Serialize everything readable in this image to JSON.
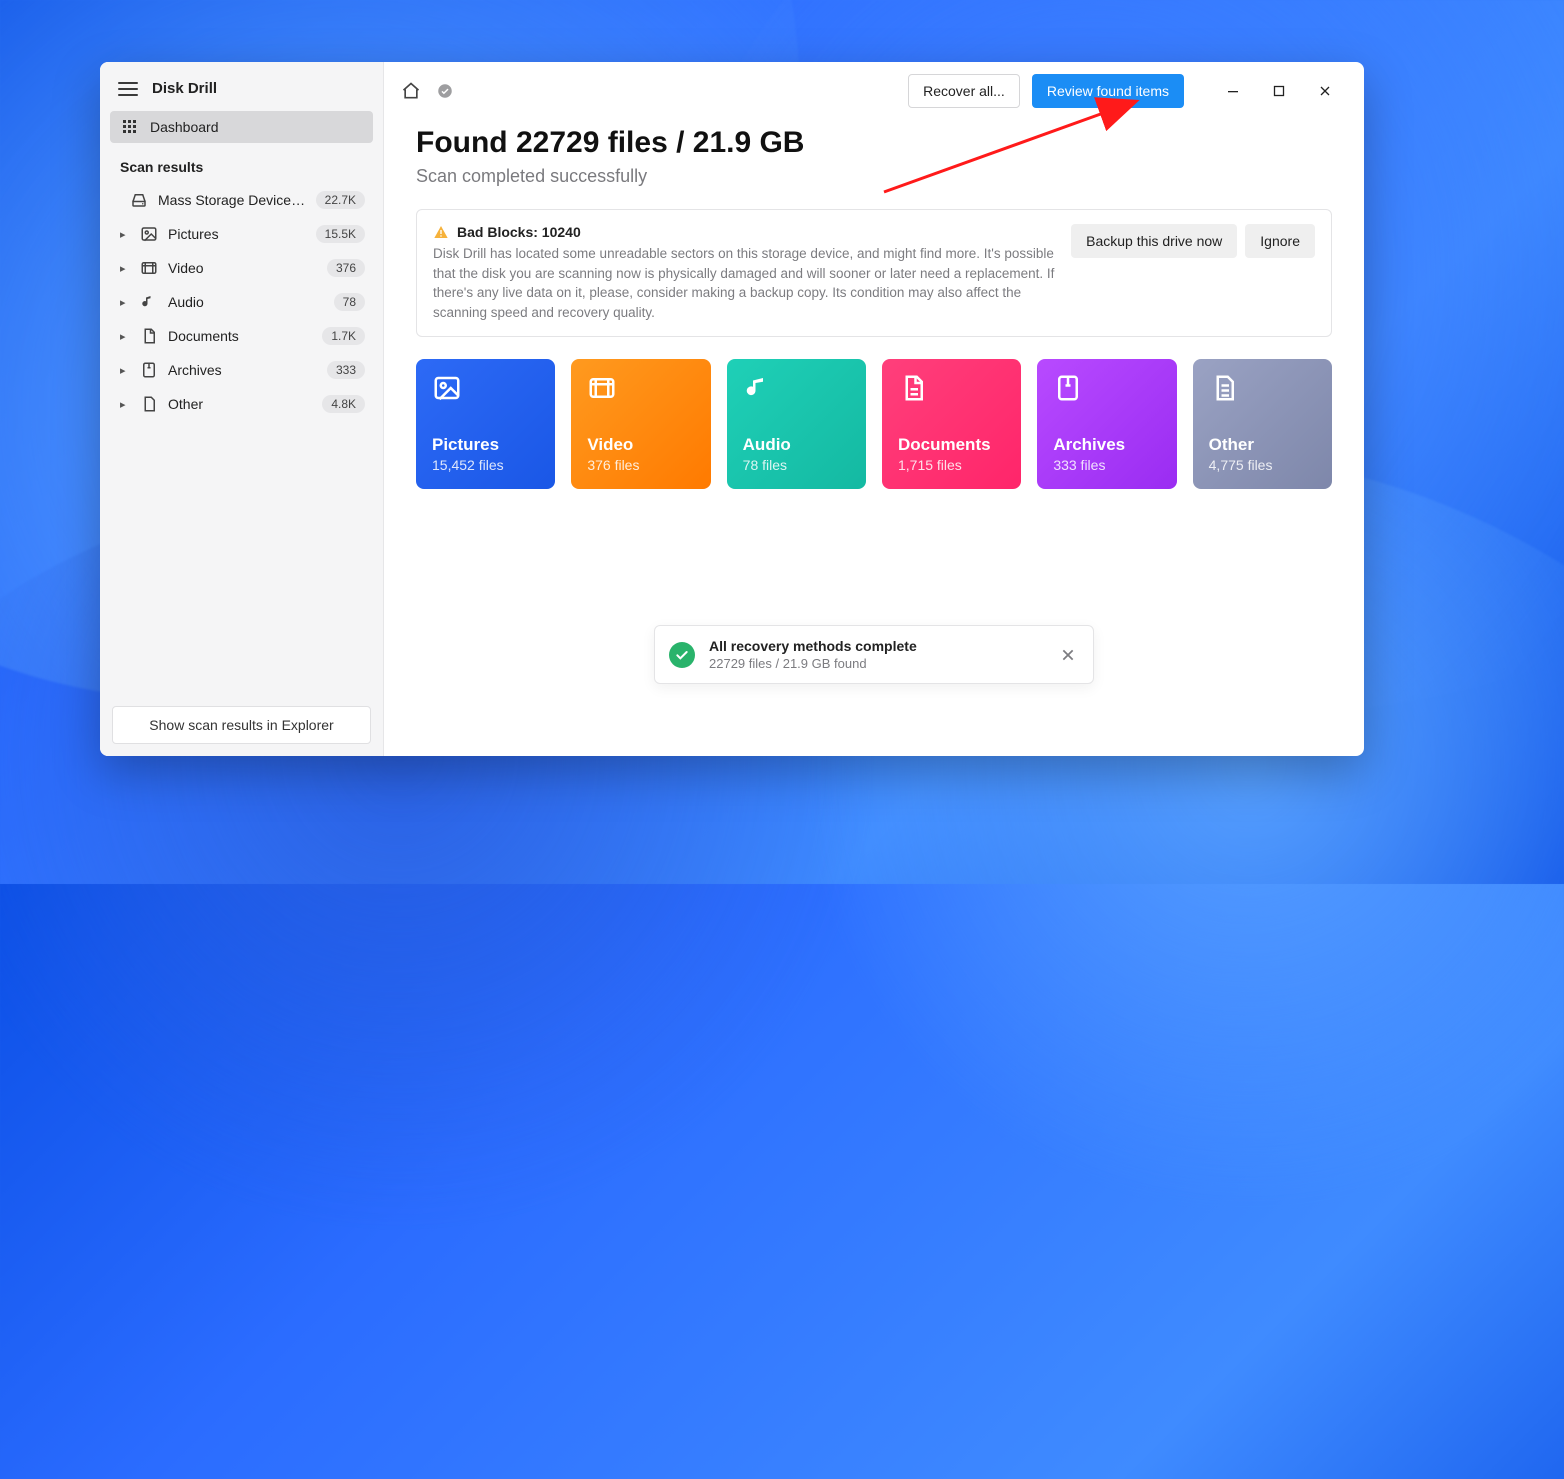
{
  "app": {
    "title": "Disk Drill"
  },
  "sidebar": {
    "dashboard_label": "Dashboard",
    "section_label": "Scan results",
    "device": {
      "label": "Mass Storage Device U...",
      "count": "22.7K"
    },
    "items": [
      {
        "icon": "picture",
        "label": "Pictures",
        "count": "15.5K"
      },
      {
        "icon": "video",
        "label": "Video",
        "count": "376"
      },
      {
        "icon": "audio",
        "label": "Audio",
        "count": "78"
      },
      {
        "icon": "doc",
        "label": "Documents",
        "count": "1.7K"
      },
      {
        "icon": "archive",
        "label": "Archives",
        "count": "333"
      },
      {
        "icon": "other",
        "label": "Other",
        "count": "4.8K"
      }
    ],
    "footer_button": "Show scan results in Explorer"
  },
  "topbar": {
    "recover_all": "Recover all...",
    "review_found": "Review found items"
  },
  "summary": {
    "headline": "Found 22729 files / 21.9 GB",
    "subhead": "Scan completed successfully"
  },
  "alert": {
    "title": "Bad Blocks: 10240",
    "text": "Disk Drill has located some unreadable sectors on this storage device, and might find more. It's possible that the disk you are scanning now is physically damaged and will sooner or later need a replacement. If there's any live data on it, please, consider making a backup copy. Its condition may also affect the scanning speed and recovery quality.",
    "backup_btn": "Backup this drive now",
    "ignore_btn": "Ignore"
  },
  "cards": [
    {
      "key": "pictures",
      "title": "Pictures",
      "sub": "15,452 files"
    },
    {
      "key": "video",
      "title": "Video",
      "sub": "376 files"
    },
    {
      "key": "audio",
      "title": "Audio",
      "sub": "78 files"
    },
    {
      "key": "documents",
      "title": "Documents",
      "sub": "1,715 files"
    },
    {
      "key": "archives",
      "title": "Archives",
      "sub": "333 files"
    },
    {
      "key": "other",
      "title": "Other",
      "sub": "4,775 files"
    }
  ],
  "toast": {
    "title": "All recovery methods complete",
    "sub": "22729 files / 21.9 GB found"
  }
}
